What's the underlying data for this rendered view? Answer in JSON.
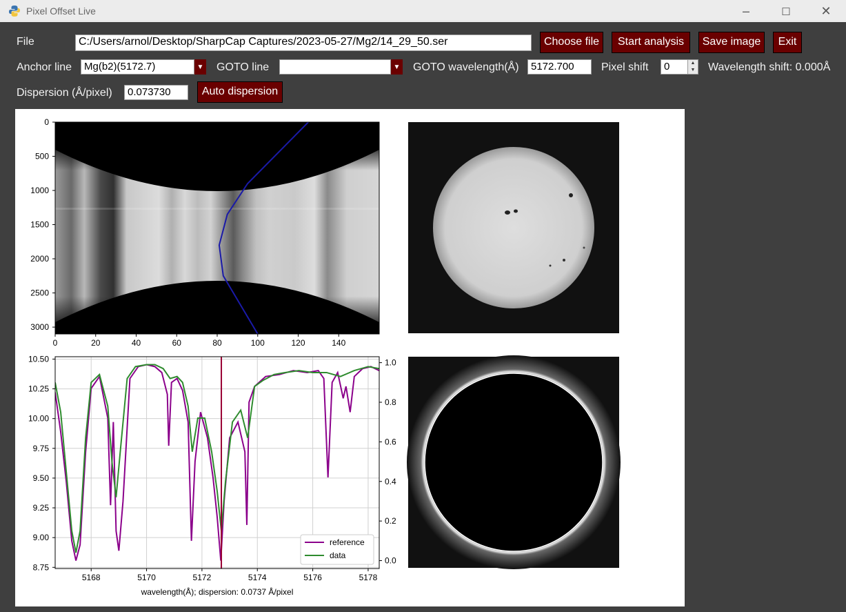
{
  "window": {
    "title": "Pixel Offset Live"
  },
  "row1": {
    "file_label": "File",
    "file_path": "C:/Users/arnol/Desktop/SharpCap Captures/2023-05-27/Mg2/14_29_50.ser",
    "choose_file": "Choose file",
    "start_analysis": "Start analysis",
    "save_image": "Save image",
    "exit": "Exit"
  },
  "row2": {
    "anchor_label": "Anchor line",
    "anchor_value": "Mg(b2)(5172.7)",
    "goto_line_label": "GOTO line",
    "goto_line_value": "",
    "goto_wl_label": "GOTO wavelength(Å)",
    "goto_wl_value": "5172.700",
    "pixel_shift_label": "Pixel shift",
    "pixel_shift_value": "0",
    "wavelength_shift": "Wavelength shift: 0.000Å"
  },
  "row3": {
    "dispersion_label": "Dispersion (Å/pixel)",
    "dispersion_value": "0.073730",
    "auto_dispersion": "Auto dispersion"
  },
  "chart_data": [
    {
      "type": "heatmap",
      "description_axes": "spectral image with fitted curve",
      "x_ticks": [
        "0",
        "20",
        "40",
        "60",
        "80",
        "100",
        "120",
        "140"
      ],
      "y_ticks": [
        "0",
        "500",
        "1000",
        "1500",
        "2000",
        "2500",
        "3000"
      ],
      "xlim": [
        0,
        160
      ],
      "ylim": [
        3100,
        0
      ],
      "curve_color": "#1a1aa8",
      "curve": {
        "x": [
          125,
          110,
          95,
          85,
          81,
          83,
          92,
          100
        ],
        "y": [
          0,
          450,
          900,
          1350,
          1800,
          2250,
          2700,
          3100
        ]
      }
    },
    {
      "type": "line",
      "xlabel": "wavelength(Å); dispersion: 0.0737 Å/pixel",
      "x_ticks": [
        "5168",
        "5170",
        "5172",
        "5174",
        "5176",
        "5178"
      ],
      "y_ticks": [
        "8.75",
        "9.00",
        "9.25",
        "9.50",
        "9.75",
        "10.00",
        "10.25",
        "10.50"
      ],
      "y2_ticks": [
        "0.0",
        "0.2",
        "0.4",
        "0.6",
        "0.8",
        "1.0"
      ],
      "xlim": [
        5166.7,
        5178.4
      ],
      "ylim": [
        8.74,
        10.52
      ],
      "y2lim": [
        -0.04,
        1.03
      ],
      "marker_x": 5172.7,
      "marker_color": "#990033",
      "grid": true,
      "legend_position": "bottom-right",
      "series": [
        {
          "name": "reference",
          "color": "#8b008b",
          "x": [
            5166.7,
            5166.9,
            5167.1,
            5167.3,
            5167.45,
            5167.6,
            5167.8,
            5168.0,
            5168.3,
            5168.6,
            5168.7,
            5168.8,
            5168.9,
            5169.0,
            5169.15,
            5169.4,
            5169.7,
            5170.0,
            5170.3,
            5170.55,
            5170.75,
            5170.8,
            5170.9,
            5171.1,
            5171.3,
            5171.5,
            5171.62,
            5171.75,
            5171.95,
            5172.2,
            5172.4,
            5172.55,
            5172.68,
            5172.8,
            5173.0,
            5173.3,
            5173.55,
            5173.62,
            5173.7,
            5173.9,
            5174.3,
            5174.8,
            5175.3,
            5175.8,
            5176.2,
            5176.4,
            5176.55,
            5176.7,
            5176.9,
            5177.1,
            5177.2,
            5177.35,
            5177.5,
            5177.8,
            5178.1,
            5178.4
          ],
          "y": [
            0.85,
            0.65,
            0.4,
            0.1,
            0.0,
            0.08,
            0.55,
            0.87,
            0.93,
            0.72,
            0.28,
            0.7,
            0.15,
            0.05,
            0.3,
            0.92,
            0.98,
            0.99,
            0.98,
            0.95,
            0.84,
            0.58,
            0.9,
            0.92,
            0.86,
            0.7,
            0.1,
            0.5,
            0.75,
            0.62,
            0.42,
            0.22,
            0.0,
            0.3,
            0.62,
            0.7,
            0.55,
            0.18,
            0.8,
            0.88,
            0.93,
            0.94,
            0.96,
            0.95,
            0.96,
            0.92,
            0.42,
            0.9,
            0.95,
            0.82,
            0.88,
            0.75,
            0.93,
            0.97,
            0.98,
            0.96
          ]
        },
        {
          "name": "data",
          "color": "#2e8b2e",
          "x": [
            5166.7,
            5166.9,
            5167.1,
            5167.3,
            5167.45,
            5167.6,
            5167.8,
            5168.0,
            5168.3,
            5168.6,
            5168.75,
            5168.9,
            5169.05,
            5169.3,
            5169.6,
            5170.0,
            5170.3,
            5170.6,
            5170.85,
            5171.1,
            5171.3,
            5171.5,
            5171.65,
            5171.85,
            5172.1,
            5172.35,
            5172.55,
            5172.7,
            5172.85,
            5173.1,
            5173.4,
            5173.65,
            5173.9,
            5174.2,
            5174.6,
            5175.0,
            5175.5,
            5176.0,
            5176.5,
            5177.0,
            5177.5,
            5178.0,
            5178.4
          ],
          "y": [
            0.9,
            0.75,
            0.45,
            0.15,
            0.04,
            0.15,
            0.62,
            0.9,
            0.94,
            0.78,
            0.5,
            0.32,
            0.55,
            0.92,
            0.98,
            0.99,
            0.99,
            0.97,
            0.92,
            0.93,
            0.9,
            0.78,
            0.55,
            0.72,
            0.72,
            0.55,
            0.35,
            0.15,
            0.4,
            0.7,
            0.76,
            0.62,
            0.88,
            0.91,
            0.94,
            0.95,
            0.96,
            0.95,
            0.95,
            0.93,
            0.96,
            0.98,
            0.97
          ]
        }
      ]
    }
  ]
}
